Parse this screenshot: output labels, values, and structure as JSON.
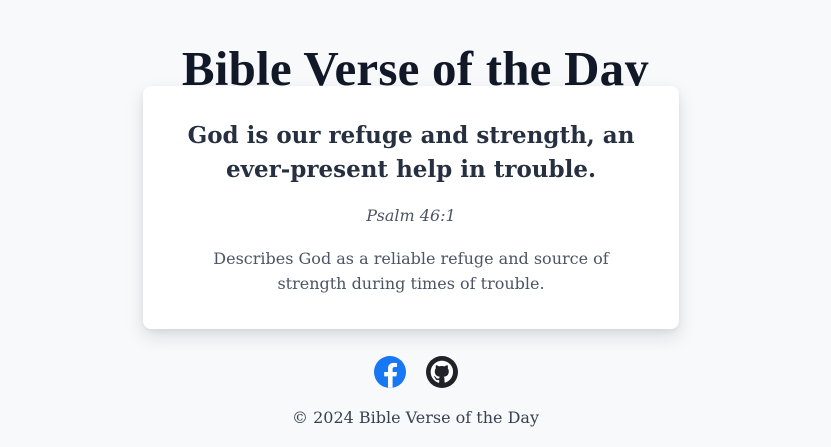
{
  "header": {
    "title": "Bible Verse of the Day"
  },
  "verse_card": {
    "text": "God is our refuge and strength, an ever-present help in trouble.",
    "reference": "Psalm 46:1",
    "description": "Describes God as a reliable refuge and source of strength during times of trouble."
  },
  "social": {
    "facebook_icon": "facebook-icon",
    "github_icon": "github-icon",
    "facebook_color": "#1877F2",
    "github_color": "#1f2328"
  },
  "footer": {
    "copyright": "© 2024 Bible Verse of the Day"
  }
}
